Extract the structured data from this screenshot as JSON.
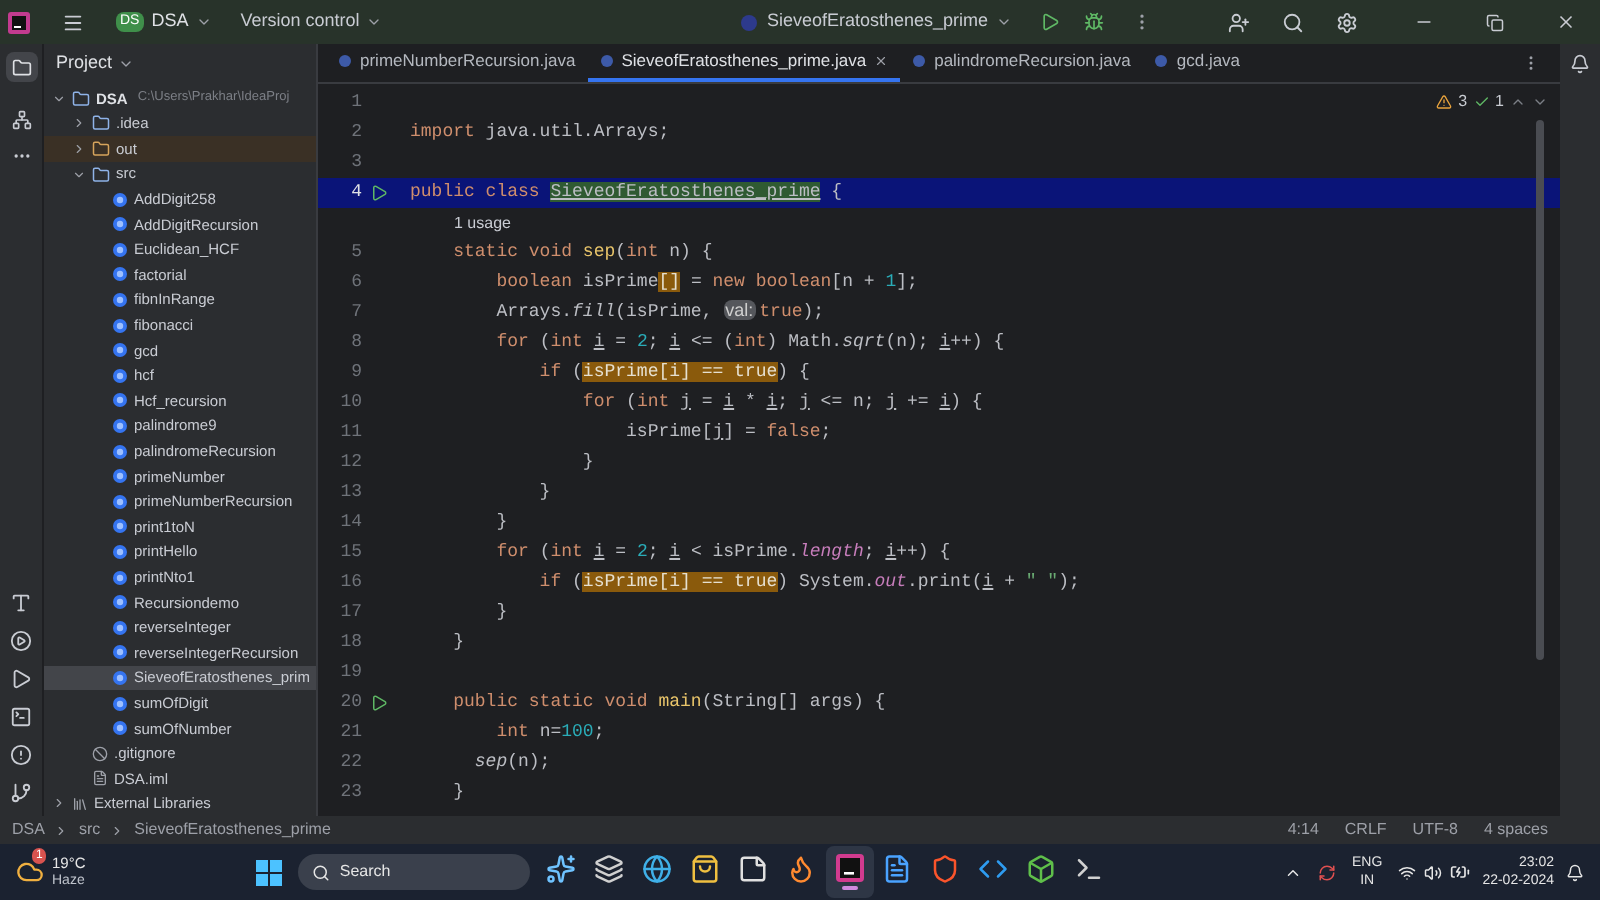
{
  "title_bar": {
    "project_badge": "DS",
    "project": "DSA",
    "version_control": "Version control",
    "run_config": "SieveofEratosthenes_prime"
  },
  "project_panel": {
    "title": "Project",
    "tree": [
      {
        "label": "DSA",
        "path": "C:\\Users\\Prakhar\\IdeaProj",
        "kind": "module",
        "expanded": true,
        "selected": false,
        "children": [
          {
            "label": ".idea",
            "kind": "folder",
            "expanded": false,
            "selected": false
          },
          {
            "label": "out",
            "kind": "excluded",
            "expanded": false,
            "selected": false
          },
          {
            "label": "src",
            "kind": "folder",
            "expanded": true,
            "selected": false,
            "children": [
              {
                "label": "AddDigit258",
                "kind": "class",
                "selected": false
              },
              {
                "label": "AddDigitRecursion",
                "kind": "class",
                "selected": false
              },
              {
                "label": "Euclidean_HCF",
                "kind": "class",
                "selected": false
              },
              {
                "label": "factorial",
                "kind": "class",
                "selected": false
              },
              {
                "label": "fibnInRange",
                "kind": "class",
                "selected": false
              },
              {
                "label": "fibonacci",
                "kind": "class",
                "selected": false
              },
              {
                "label": "gcd",
                "kind": "class",
                "selected": false
              },
              {
                "label": "hcf",
                "kind": "class",
                "selected": false
              },
              {
                "label": "Hcf_recursion",
                "kind": "class",
                "selected": false
              },
              {
                "label": "palindrome9",
                "kind": "class",
                "selected": false
              },
              {
                "label": "palindromeRecursion",
                "kind": "class",
                "selected": false
              },
              {
                "label": "primeNumber",
                "kind": "class",
                "selected": false
              },
              {
                "label": "primeNumberRecursion",
                "kind": "class",
                "selected": false
              },
              {
                "label": "print1toN",
                "kind": "class",
                "selected": false
              },
              {
                "label": "printHello",
                "kind": "class",
                "selected": false
              },
              {
                "label": "printNto1",
                "kind": "class",
                "selected": false
              },
              {
                "label": "Recursiondemo",
                "kind": "class",
                "selected": false
              },
              {
                "label": "reverseInteger",
                "kind": "class",
                "selected": false
              },
              {
                "label": "reverseIntegerRecursion",
                "kind": "class",
                "selected": false
              },
              {
                "label": "SieveofEratosthenes_prim",
                "kind": "class",
                "selected": true
              },
              {
                "label": "sumOfDigit",
                "kind": "class",
                "selected": false
              },
              {
                "label": "sumOfNumber",
                "kind": "class",
                "selected": false
              }
            ]
          },
          {
            "label": ".gitignore",
            "kind": "ignore",
            "selected": false
          },
          {
            "label": "DSA.iml",
            "kind": "iml",
            "selected": false
          }
        ]
      },
      {
        "label": "External Libraries",
        "kind": "library",
        "expanded": false,
        "selected": false
      }
    ]
  },
  "tabs": [
    {
      "label": "primeNumberRecursion.java",
      "selected": false
    },
    {
      "label": "SieveofEratosthenes_prime.java",
      "selected": true
    },
    {
      "label": "palindromeRecursion.java",
      "selected": false
    },
    {
      "label": "gcd.java",
      "selected": false
    }
  ],
  "editor": {
    "warnings": "3",
    "checks": "1",
    "lines": [
      {
        "kind": "code",
        "number": "1",
        "run": false,
        "current": false
      },
      {
        "kind": "code",
        "number": "2",
        "run": false,
        "current": false,
        "tokens": [
          {
            "text": "import",
            "kind": "kw"
          },
          {
            "text": " java.util.Arrays;",
            "kind": "plain"
          }
        ]
      },
      {
        "kind": "code",
        "number": "3",
        "run": false,
        "current": false
      },
      {
        "kind": "code",
        "number": "4",
        "run": true,
        "current": true,
        "tokens": [
          {
            "text": "public class ",
            "kind": "kw"
          },
          {
            "text": "SieveofEratosthenes_prime",
            "kind": "cls"
          },
          {
            "text": " {",
            "kind": "plain"
          }
        ]
      },
      {
        "kind": "inlay",
        "text": "1 usage"
      },
      {
        "kind": "code",
        "number": "5",
        "run": false,
        "current": false,
        "tokens": [
          {
            "text": "    static void ",
            "kind": "kw"
          },
          {
            "text": "sep",
            "kind": "decl"
          },
          {
            "text": "(",
            "kind": "plain"
          },
          {
            "text": "int ",
            "kind": "kw"
          },
          {
            "text": "n) {",
            "kind": "plain"
          }
        ]
      },
      {
        "kind": "code",
        "number": "6",
        "run": false,
        "current": false,
        "tokens": [
          {
            "text": "        boolean ",
            "kind": "kw"
          },
          {
            "text": "isPrime",
            "kind": "plain"
          },
          {
            "text": "[]",
            "kind": "warn"
          },
          {
            "text": " = ",
            "kind": "plain"
          },
          {
            "text": "new boolean",
            "kind": "kw"
          },
          {
            "text": "[n + ",
            "kind": "plain"
          },
          {
            "text": "1",
            "kind": "num"
          },
          {
            "text": "];",
            "kind": "plain"
          }
        ]
      },
      {
        "kind": "code",
        "number": "7",
        "run": false,
        "current": false,
        "tokens": [
          {
            "text": "        Arrays.",
            "kind": "plain"
          },
          {
            "text": "fill",
            "kind": "italic"
          },
          {
            "text": "(isPrime, ",
            "kind": "plain"
          },
          {
            "text": "val:",
            "kind": "hint"
          },
          {
            "text": "true",
            "kind": "kw"
          },
          {
            "text": ");",
            "kind": "plain"
          }
        ]
      },
      {
        "kind": "code",
        "number": "8",
        "run": false,
        "current": false,
        "tokens": [
          {
            "text": "        for ",
            "kind": "kw"
          },
          {
            "text": "(",
            "kind": "plain"
          },
          {
            "text": "int ",
            "kind": "kw"
          },
          {
            "text": "i",
            "kind": "var"
          },
          {
            "text": " = ",
            "kind": "plain"
          },
          {
            "text": "2",
            "kind": "num"
          },
          {
            "text": "; ",
            "kind": "plain"
          },
          {
            "text": "i",
            "kind": "var"
          },
          {
            "text": " <= (",
            "kind": "plain"
          },
          {
            "text": "int",
            "kind": "kw"
          },
          {
            "text": ") Math.",
            "kind": "plain"
          },
          {
            "text": "sqrt",
            "kind": "italic"
          },
          {
            "text": "(n); ",
            "kind": "plain"
          },
          {
            "text": "i",
            "kind": "var"
          },
          {
            "text": "++) {",
            "kind": "plain"
          }
        ]
      },
      {
        "kind": "code",
        "number": "9",
        "run": false,
        "current": false,
        "tokens": [
          {
            "text": "            if ",
            "kind": "kw"
          },
          {
            "text": "(",
            "kind": "plain"
          },
          {
            "text": "isPrime[i] == true",
            "kind": "warn"
          },
          {
            "text": ") {",
            "kind": "plain"
          }
        ]
      },
      {
        "kind": "code",
        "number": "10",
        "run": false,
        "current": false,
        "tokens": [
          {
            "text": "                for ",
            "kind": "kw"
          },
          {
            "text": "(",
            "kind": "plain"
          },
          {
            "text": "int ",
            "kind": "kw"
          },
          {
            "text": "j",
            "kind": "var"
          },
          {
            "text": " = ",
            "kind": "plain"
          },
          {
            "text": "i",
            "kind": "var"
          },
          {
            "text": " * ",
            "kind": "plain"
          },
          {
            "text": "i",
            "kind": "var"
          },
          {
            "text": "; ",
            "kind": "plain"
          },
          {
            "text": "j",
            "kind": "var"
          },
          {
            "text": " <= n; ",
            "kind": "plain"
          },
          {
            "text": "j",
            "kind": "var"
          },
          {
            "text": " += ",
            "kind": "plain"
          },
          {
            "text": "i",
            "kind": "var"
          },
          {
            "text": ") {",
            "kind": "plain"
          }
        ]
      },
      {
        "kind": "code",
        "number": "11",
        "run": false,
        "current": false,
        "tokens": [
          {
            "text": "                    isPrime[",
            "kind": "plain"
          },
          {
            "text": "j",
            "kind": "var"
          },
          {
            "text": "] = ",
            "kind": "plain"
          },
          {
            "text": "false",
            "kind": "kw"
          },
          {
            "text": ";",
            "kind": "plain"
          }
        ]
      },
      {
        "kind": "code",
        "number": "12",
        "run": false,
        "current": false,
        "tokens": [
          {
            "text": "                }",
            "kind": "plain"
          }
        ]
      },
      {
        "kind": "code",
        "number": "13",
        "run": false,
        "current": false,
        "tokens": [
          {
            "text": "            }",
            "kind": "plain"
          }
        ]
      },
      {
        "kind": "code",
        "number": "14",
        "run": false,
        "current": false,
        "tokens": [
          {
            "text": "        }",
            "kind": "plain"
          }
        ]
      },
      {
        "kind": "code",
        "number": "15",
        "run": false,
        "current": false,
        "tokens": [
          {
            "text": "        for ",
            "kind": "kw"
          },
          {
            "text": "(",
            "kind": "plain"
          },
          {
            "text": "int ",
            "kind": "kw"
          },
          {
            "text": "i",
            "kind": "var"
          },
          {
            "text": " = ",
            "kind": "plain"
          },
          {
            "text": "2",
            "kind": "num"
          },
          {
            "text": "; ",
            "kind": "plain"
          },
          {
            "text": "i",
            "kind": "var"
          },
          {
            "text": " < isPrime.",
            "kind": "plain"
          },
          {
            "text": "length",
            "kind": "field"
          },
          {
            "text": "; ",
            "kind": "plain"
          },
          {
            "text": "i",
            "kind": "var"
          },
          {
            "text": "++) {",
            "kind": "plain"
          }
        ]
      },
      {
        "kind": "code",
        "number": "16",
        "run": false,
        "current": false,
        "tokens": [
          {
            "text": "            if ",
            "kind": "kw"
          },
          {
            "text": "(",
            "kind": "plain"
          },
          {
            "text": "isPrime[i] == true",
            "kind": "warn"
          },
          {
            "text": ") System.",
            "kind": "plain"
          },
          {
            "text": "out",
            "kind": "field"
          },
          {
            "text": ".print(",
            "kind": "plain"
          },
          {
            "text": "i",
            "kind": "var"
          },
          {
            "text": " + ",
            "kind": "plain"
          },
          {
            "text": "\" \"",
            "kind": "str"
          },
          {
            "text": ");",
            "kind": "plain"
          }
        ]
      },
      {
        "kind": "code",
        "number": "17",
        "run": false,
        "current": false,
        "tokens": [
          {
            "text": "        }",
            "kind": "plain"
          }
        ]
      },
      {
        "kind": "code",
        "number": "18",
        "run": false,
        "current": false,
        "tokens": [
          {
            "text": "    }",
            "kind": "plain"
          }
        ]
      },
      {
        "kind": "code",
        "number": "19",
        "run": false,
        "current": false
      },
      {
        "kind": "code",
        "number": "20",
        "run": true,
        "current": false,
        "tokens": [
          {
            "text": "    public static void ",
            "kind": "kw"
          },
          {
            "text": "main",
            "kind": "decl"
          },
          {
            "text": "(String[] args) {",
            "kind": "plain"
          }
        ]
      },
      {
        "kind": "code",
        "number": "21",
        "run": false,
        "current": false,
        "tokens": [
          {
            "text": "        int ",
            "kind": "kw"
          },
          {
            "text": "n=",
            "kind": "plain"
          },
          {
            "text": "100",
            "kind": "num"
          },
          {
            "text": ";",
            "kind": "plain"
          }
        ]
      },
      {
        "kind": "code",
        "number": "22",
        "run": false,
        "current": false,
        "tokens": [
          {
            "text": "      sep",
            "kind": "italic"
          },
          {
            "text": "(n);",
            "kind": "plain"
          }
        ]
      },
      {
        "kind": "code",
        "number": "23",
        "run": false,
        "current": false,
        "tokens": [
          {
            "text": "    }",
            "kind": "plain"
          }
        ]
      }
    ]
  },
  "status_bar": {
    "breadcrumbs": [
      "DSA",
      "src",
      "SieveofEratosthenes_prime"
    ],
    "position": "4:14",
    "line_separator": "CRLF",
    "encoding": "UTF-8",
    "indent": "4 spaces"
  },
  "taskbar": {
    "weather": {
      "temperature": "19°C",
      "condition": "Haze",
      "badge": "1"
    },
    "search": "Search",
    "apps": [
      {
        "kind": "copilot",
        "active": false
      },
      {
        "kind": "taskview",
        "active": false
      },
      {
        "kind": "edge",
        "active": false
      },
      {
        "kind": "store",
        "active": false
      },
      {
        "kind": "notepad",
        "active": false
      },
      {
        "kind": "firefox",
        "active": false
      },
      {
        "kind": "intellij",
        "active": true
      },
      {
        "kind": "notes",
        "active": false
      },
      {
        "kind": "brave",
        "active": false
      },
      {
        "kind": "vscode",
        "active": false
      },
      {
        "kind": "cube",
        "active": false
      },
      {
        "kind": "terminal",
        "active": false
      }
    ],
    "language": "ENG",
    "region": "IN",
    "time": "23:02",
    "date": "22-02-2024"
  }
}
